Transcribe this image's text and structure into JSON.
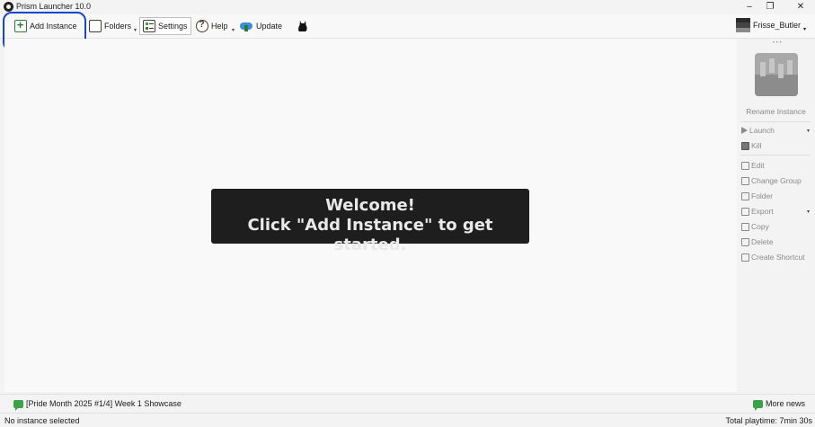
{
  "window": {
    "title": "Prism Launcher 10.0"
  },
  "toolbar": {
    "add_instance": "Add Instance",
    "folders": "Folders",
    "settings": "Settings",
    "help": "Help",
    "update": "Update"
  },
  "account": {
    "name": "Frisse_Butler"
  },
  "main": {
    "welcome_line1": "Welcome!",
    "welcome_line2": "Click \"Add Instance\" to get started."
  },
  "instance_panel": {
    "rename": "Rename Instance",
    "actions": {
      "launch": "Launch",
      "kill": "Kill",
      "edit": "Edit",
      "change_group": "Change Group",
      "folder": "Folder",
      "export": "Export",
      "copy": "Copy",
      "delete": "Delete",
      "create_shortcut": "Create Shortcut"
    }
  },
  "news": {
    "headline": "[Pride Month 2025 #1/4] Week 1 Showcase",
    "more": "More news"
  },
  "status": {
    "selection": "No instance selected",
    "playtime": "Total playtime: 7min 30s"
  },
  "colors": {
    "annotation": "#1846c8",
    "accent_green": "#2d7a36",
    "welcome_bg": "#1e1e1e"
  }
}
